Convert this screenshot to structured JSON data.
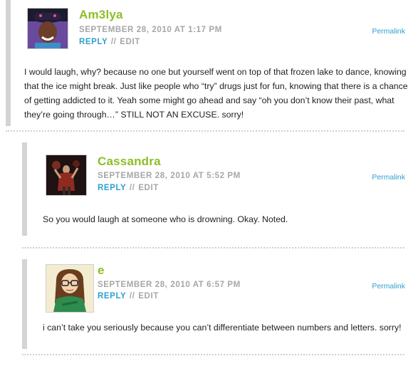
{
  "comments": [
    {
      "author": "Am3lya",
      "date": "SEPTEMBER 28, 2010 AT 1:17 PM",
      "reply_label": "REPLY",
      "separator": "//",
      "edit_label": "EDIT",
      "permalink_label": "Permalink",
      "text": "I would laugh, why? because no one but yourself went on top of that frozen lake to dance, knowing that the ice might break. Just like people who “try” drugs just for fun, knowing that there is a chance of getting addicted to it. Yeah some might go ahead and say “oh you don’t know their past, what they’re going through…” STILL NOT AN EXCUSE. sorry!"
    },
    {
      "author": "Cassandra",
      "date": "SEPTEMBER 28, 2010 AT 5:52 PM",
      "reply_label": "REPLY",
      "separator": "//",
      "edit_label": "EDIT",
      "permalink_label": "Permalink",
      "text": "So you would laugh at someone who is drowning. Okay. Noted."
    },
    {
      "author": "e",
      "date": "SEPTEMBER 28, 2010 AT 6:57 PM",
      "reply_label": "REPLY",
      "separator": "//",
      "edit_label": "EDIT",
      "permalink_label": "Permalink",
      "text": "i can’t take you seriously because you can’t differentiate between numbers and letters. sorry!"
    }
  ]
}
